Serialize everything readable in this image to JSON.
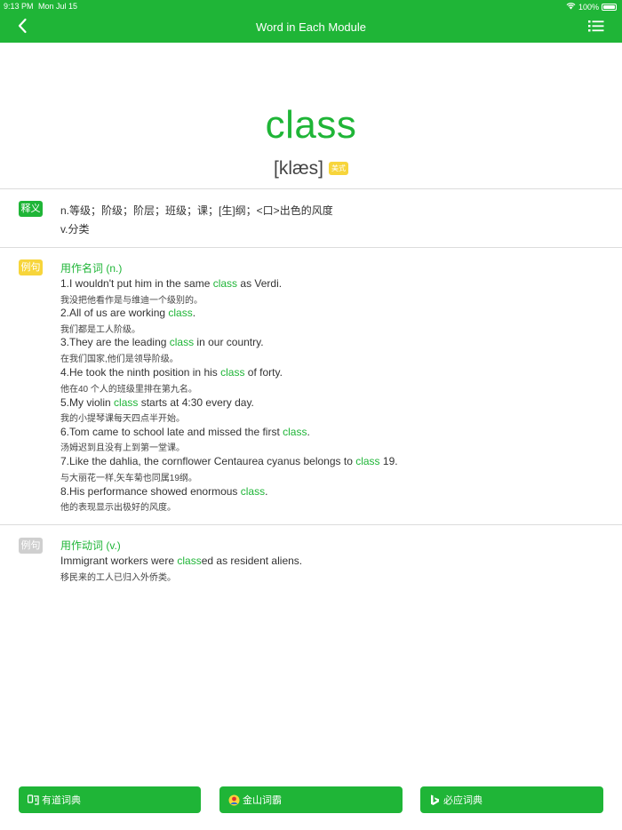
{
  "status": {
    "time": "9:13 PM",
    "date": "Mon Jul 15",
    "battery": "100%"
  },
  "nav": {
    "title": "Word in Each Module",
    "back_icon": "chevron-left-icon",
    "list_icon": "list-icon"
  },
  "word": "class",
  "phonetic": "[klæs]",
  "phonetic_badge": "美式",
  "definition": {
    "tag": "释义",
    "lines": [
      "n.等级；阶级；阶层；班级；课；[生]纲；<口>出色的风度",
      "v.分类"
    ]
  },
  "noun_section": {
    "tag": "例句",
    "heading": "用作名词 (n.)",
    "examples": [
      {
        "en_pre": "1.I wouldn't put him in the same ",
        "hl": "class",
        "en_post": " as Verdi.",
        "cn": "我没把他看作是与维迪一个级别的。"
      },
      {
        "en_pre": "2.All of us are working ",
        "hl": "class",
        "en_post": ".",
        "cn": "我们都是工人阶级。"
      },
      {
        "en_pre": "3.They are the leading ",
        "hl": "class",
        "en_post": " in our country.",
        "cn": "在我们国家,他们是领导阶级。"
      },
      {
        "en_pre": "4.He took the ninth position in his ",
        "hl": "class",
        "en_post": " of forty.",
        "cn": "他在40 个人的班级里排在第九名。"
      },
      {
        "en_pre": "5.My violin ",
        "hl": "class",
        "en_post": " starts at 4:30 every day.",
        "cn": "我的小提琴课每天四点半开始。"
      },
      {
        "en_pre": "6.Tom came to school late and missed the first ",
        "hl": "class",
        "en_post": ".",
        "cn": "汤姆迟到且没有上到第一堂课。"
      },
      {
        "en_pre": "7.Like the dahlia, the cornflower Centaurea cyanus belongs to ",
        "hl": "class",
        "en_post": " 19.",
        "cn": "与大丽花一样,矢车菊也同属19纲。"
      },
      {
        "en_pre": "8.His performance showed enormous ",
        "hl": "class",
        "en_post": ".",
        "cn": "他的表现显示出极好的风度。"
      }
    ]
  },
  "verb_section": {
    "tag": "例句",
    "heading": "用作动词 (v.)",
    "examples": [
      {
        "en_pre": "Immigrant workers were ",
        "hl": "class",
        "en_post": "ed as resident aliens.",
        "cn": "移民来的工人已归入外侨类。"
      }
    ]
  },
  "buttons": [
    {
      "label": "有道词典",
      "icon": "youdao-icon"
    },
    {
      "label": "金山词霸",
      "icon": "jinshan-icon"
    },
    {
      "label": "必应词典",
      "icon": "bing-icon"
    }
  ],
  "colors": {
    "accent": "#1fb537",
    "badge_yellow": "#f7d53b",
    "badge_gray": "#cfcfcf"
  }
}
